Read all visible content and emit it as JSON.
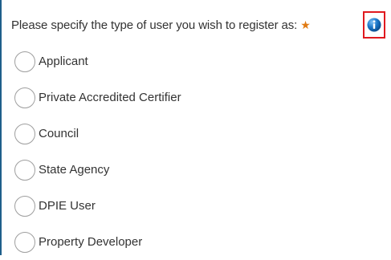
{
  "question": {
    "text": "Please specify the type of user you wish to register as:",
    "required_marker": "★",
    "info_icon": "info-icon"
  },
  "options": [
    {
      "label": "Applicant",
      "selected": false
    },
    {
      "label": "Private Accredited Certifier",
      "selected": false
    },
    {
      "label": "Council",
      "selected": false
    },
    {
      "label": "State Agency",
      "selected": false
    },
    {
      "label": "DPIE User",
      "selected": false
    },
    {
      "label": "Property Developer",
      "selected": false
    }
  ],
  "colors": {
    "left_border": "#1f5f8b",
    "required_star": "#e07a12",
    "info_highlight_border": "#e0191f",
    "info_icon_fill": "#1b77c9"
  }
}
